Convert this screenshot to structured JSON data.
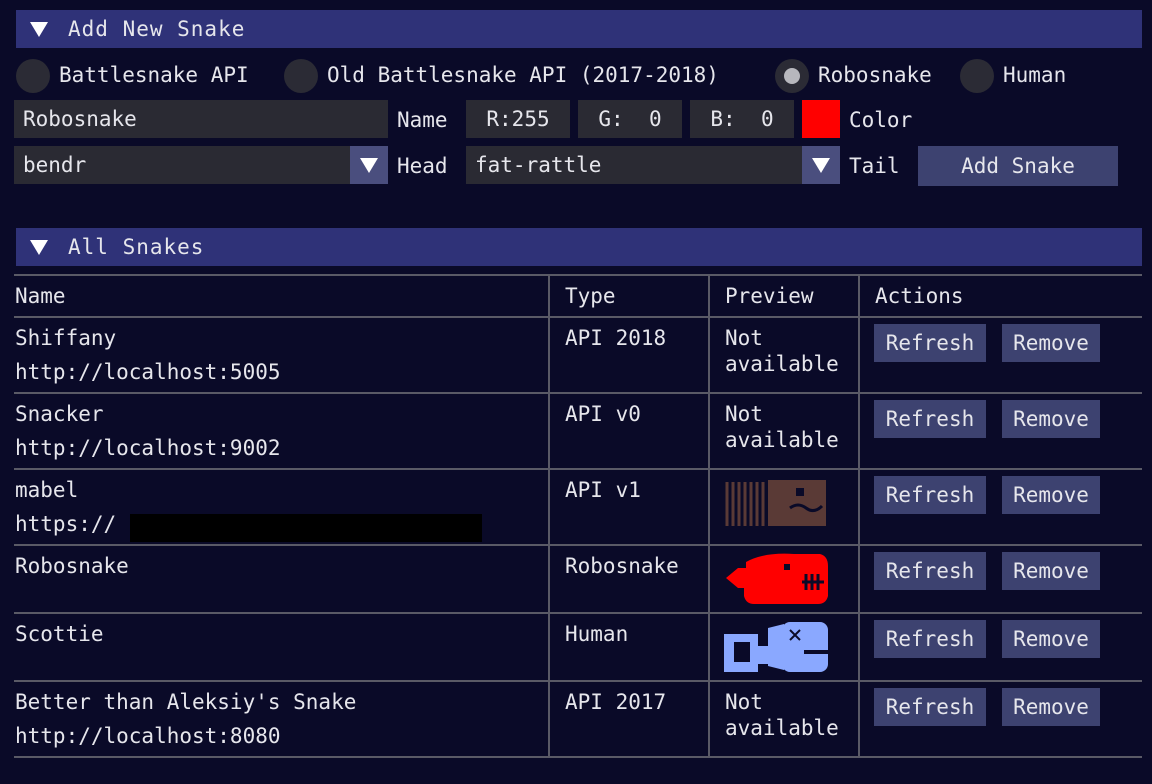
{
  "add_section": {
    "title": "Add New Snake",
    "types": [
      {
        "label": "Battlesnake API",
        "selected": false
      },
      {
        "label": "Old Battlesnake API (2017-2018)",
        "selected": false
      },
      {
        "label": "Robosnake",
        "selected": true
      },
      {
        "label": "Human",
        "selected": false
      }
    ],
    "name_value": "Robosnake",
    "name_label": "Name",
    "r": "R:255",
    "g": "G:  0",
    "b": "B:  0",
    "color_value": "#ff0000",
    "color_label": "Color",
    "head_value": "bendr",
    "head_label": "Head",
    "tail_value": "fat-rattle",
    "tail_label": "Tail",
    "add_button": "Add Snake"
  },
  "all_section": {
    "title": "All Snakes",
    "columns": [
      "Name",
      "Type",
      "Preview",
      "Actions"
    ],
    "rows": [
      {
        "name": "Shiffany",
        "url": "http://localhost:5005",
        "type": "API 2018",
        "preview_line1": "Not",
        "preview_line2": "available",
        "refresh": "Refresh",
        "remove": "Remove"
      },
      {
        "name": "Snacker",
        "url": "http://localhost:9002",
        "type": "API v0",
        "preview_line1": "Not",
        "preview_line2": "available",
        "refresh": "Refresh",
        "remove": "Remove"
      },
      {
        "name": "mabel",
        "url": "https://",
        "type": "API v1",
        "preview_color": "#5a3a36",
        "refresh": "Refresh",
        "remove": "Remove"
      },
      {
        "name": "Robosnake",
        "url": "",
        "type": "Robosnake",
        "preview_color": "#ff0000",
        "refresh": "Refresh",
        "remove": "Remove"
      },
      {
        "name": "Scottie",
        "url": "",
        "type": "Human",
        "preview_color": "#8aa8ff",
        "refresh": "Refresh",
        "remove": "Remove"
      },
      {
        "name": "Better than Aleksiy's Snake",
        "url": "http://localhost:8080",
        "type": "API 2017",
        "preview_line1": "Not",
        "preview_line2": "available",
        "refresh": "Refresh",
        "remove": "Remove"
      }
    ]
  }
}
